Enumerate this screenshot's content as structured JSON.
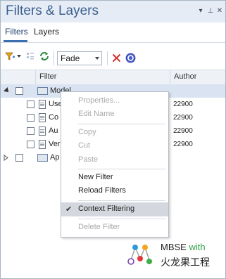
{
  "window": {
    "title": "Filters & Layers",
    "buttons": [
      "▾",
      "⊥",
      "✕"
    ]
  },
  "tabs": [
    {
      "label": "Filters",
      "active": true
    },
    {
      "label": "Layers",
      "active": false
    }
  ],
  "toolbar": {
    "mode_value": "Fade",
    "icons": [
      "add-filter-icon",
      "options-icon",
      "refresh-icon",
      "delete-icon",
      "help-icon"
    ]
  },
  "grid": {
    "columns": [
      "Filter",
      "Author"
    ],
    "rows": [
      {
        "name": "Model",
        "author": "",
        "selected": true
      },
      {
        "name": "Use",
        "author": "22900"
      },
      {
        "name": "Co",
        "author": "22900"
      },
      {
        "name": "Au",
        "author": "22900"
      },
      {
        "name": "Ver",
        "author": "22900"
      },
      {
        "name": "Ap",
        "author": ""
      }
    ]
  },
  "context_menu": {
    "items": [
      {
        "label": "Properties...",
        "enabled": false
      },
      {
        "label": "Edit Name",
        "enabled": false
      },
      {
        "label": "Copy",
        "enabled": false
      },
      {
        "label": "Cut",
        "enabled": false
      },
      {
        "label": "Paste",
        "enabled": false
      },
      {
        "label": "New Filter",
        "enabled": true
      },
      {
        "label": "Reload Filters",
        "enabled": true
      },
      {
        "label": "Context Filtering",
        "enabled": true,
        "checked": true
      },
      {
        "label": "Delete Filter",
        "enabled": false
      }
    ]
  },
  "brand": {
    "line1_main": "MBSE",
    "line1_with": " with",
    "line2": "火龙果工程"
  },
  "colors": {
    "title": "#3a5f8e",
    "accent": "#3b6fb0",
    "delete": "#d32f2f",
    "help": "#4b5fcf",
    "refresh": "#2e8b3e"
  }
}
